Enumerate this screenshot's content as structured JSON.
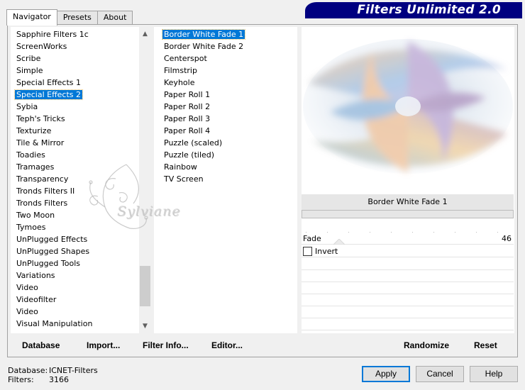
{
  "tabs": [
    "Navigator",
    "Presets",
    "About"
  ],
  "banner_title": "Filters Unlimited 2.0",
  "categories": [
    {
      "label": "Sapphire Filters 1c",
      "selected": false
    },
    {
      "label": "ScreenWorks",
      "selected": false
    },
    {
      "label": "Scribe",
      "selected": false
    },
    {
      "label": "Simple",
      "selected": false
    },
    {
      "label": "Special Effects 1",
      "selected": false
    },
    {
      "label": "Special Effects 2",
      "selected": true
    },
    {
      "label": "Sybia",
      "selected": false
    },
    {
      "label": "Teph's Tricks",
      "selected": false
    },
    {
      "label": "Texturize",
      "selected": false
    },
    {
      "label": "Tile & Mirror",
      "selected": false
    },
    {
      "label": "Toadies",
      "selected": false
    },
    {
      "label": "Tramages",
      "selected": false
    },
    {
      "label": "Transparency",
      "selected": false
    },
    {
      "label": "Tronds Filters II",
      "selected": false
    },
    {
      "label": "Tronds Filters",
      "selected": false
    },
    {
      "label": "Two Moon",
      "selected": false
    },
    {
      "label": "Tymoes",
      "selected": false
    },
    {
      "label": "UnPlugged Effects",
      "selected": false
    },
    {
      "label": "UnPlugged Shapes",
      "selected": false
    },
    {
      "label": "UnPlugged Tools",
      "selected": false
    },
    {
      "label": "Variations",
      "selected": false
    },
    {
      "label": "Video",
      "selected": false
    },
    {
      "label": "Videofilter",
      "selected": false
    },
    {
      "label": "Video",
      "selected": false
    },
    {
      "label": "Visual Manipulation",
      "selected": false
    }
  ],
  "filters": [
    {
      "label": "Border White Fade 1",
      "selected": true
    },
    {
      "label": "Border White Fade 2",
      "selected": false
    },
    {
      "label": "Centerspot",
      "selected": false
    },
    {
      "label": "Filmstrip",
      "selected": false
    },
    {
      "label": "Keyhole",
      "selected": false
    },
    {
      "label": "Paper Roll 1",
      "selected": false
    },
    {
      "label": "Paper Roll 2",
      "selected": false
    },
    {
      "label": "Paper Roll 3",
      "selected": false
    },
    {
      "label": "Paper Roll 4",
      "selected": false
    },
    {
      "label": "Puzzle (scaled)",
      "selected": false
    },
    {
      "label": "Puzzle (tiled)",
      "selected": false
    },
    {
      "label": "Rainbow",
      "selected": false
    },
    {
      "label": "TV Screen",
      "selected": false
    }
  ],
  "watermark_text": "Sylviane",
  "current_filter": "Border White Fade 1",
  "params": {
    "fade": {
      "label": "Fade",
      "value": "46"
    },
    "invert": {
      "label": "Invert",
      "checked": false
    }
  },
  "buttons": {
    "database": "Database",
    "import": "Import...",
    "filter_info": "Filter Info...",
    "editor": "Editor...",
    "randomize": "Randomize",
    "reset": "Reset",
    "apply": "Apply",
    "cancel": "Cancel",
    "help": "Help"
  },
  "status": {
    "database_label": "Database:",
    "database_value": "ICNET-Filters",
    "filters_label": "Filters:",
    "filters_value": "3166"
  },
  "colors": {
    "selection": "#0078d7",
    "banner": "#000080",
    "primary_border": "#0078d7"
  }
}
